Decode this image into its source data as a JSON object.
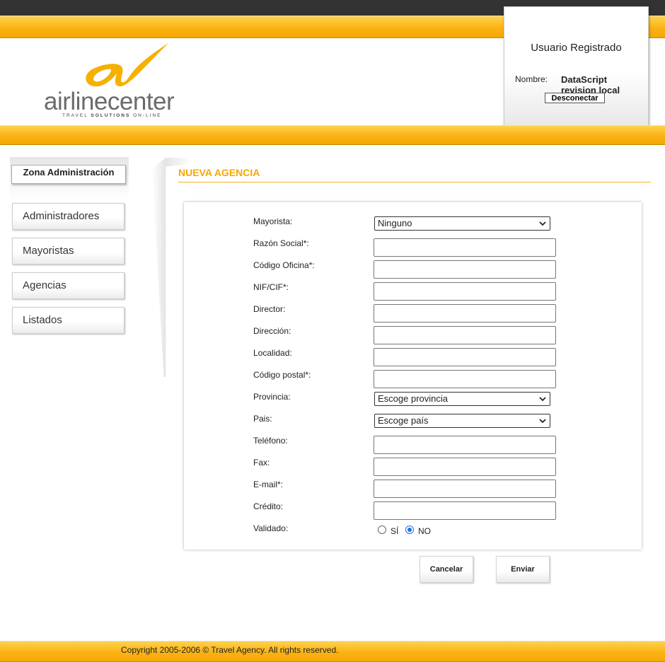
{
  "header": {
    "brand_primary": "airline",
    "brand_secondary": "center",
    "brand_tagline_pre": "TRAVEL ",
    "brand_tagline_bold": "SOLUTIONS",
    "brand_tagline_post": " ON-LINE",
    "accent_color": "#f5a800",
    "logo_icon": "swoosh-a-logo"
  },
  "user_panel": {
    "title": "Usuario Registrado",
    "name_label": "Nombre:",
    "name_value": "DataScript revision local",
    "logout_label": "Desconectar"
  },
  "sidebar": {
    "title": "Zona Administración",
    "items": [
      {
        "label": "Administradores"
      },
      {
        "label": "Mayoristas"
      },
      {
        "label": "Agencias"
      },
      {
        "label": "Listados"
      }
    ]
  },
  "page": {
    "title": "NUEVA AGENCIA"
  },
  "form": {
    "mayorista": {
      "label": "Mayorista:",
      "selected": "Ninguno"
    },
    "razon_social": {
      "label": "Razón Social*:",
      "value": ""
    },
    "codigo_oficina": {
      "label": "Código Oficina*:",
      "value": ""
    },
    "nif_cif": {
      "label": "NIF/CIF*:",
      "value": ""
    },
    "director": {
      "label": "Director:",
      "value": ""
    },
    "direccion": {
      "label": "Dirección:",
      "value": ""
    },
    "localidad": {
      "label": "Localidad:",
      "value": ""
    },
    "codigo_postal": {
      "label": "Código postal*:",
      "value": ""
    },
    "provincia": {
      "label": "Provincia:",
      "selected": "Escoge provincia"
    },
    "pais": {
      "label": "Pais:",
      "selected": "Escoge país"
    },
    "telefono": {
      "label": "Teléfono:",
      "value": ""
    },
    "fax": {
      "label": "Fax:",
      "value": ""
    },
    "email": {
      "label": "E-mail*:",
      "value": ""
    },
    "credito": {
      "label": "Crédito:",
      "value": ""
    },
    "validado": {
      "label": "Validado:",
      "option_yes": "SÍ",
      "option_no": "NO",
      "selected": "NO"
    }
  },
  "actions": {
    "cancel_label": "Cancelar",
    "submit_label": "Enviar"
  },
  "footer": {
    "copyright": "Copyright 2005-2006 © Travel Agency. All rights reserved."
  }
}
